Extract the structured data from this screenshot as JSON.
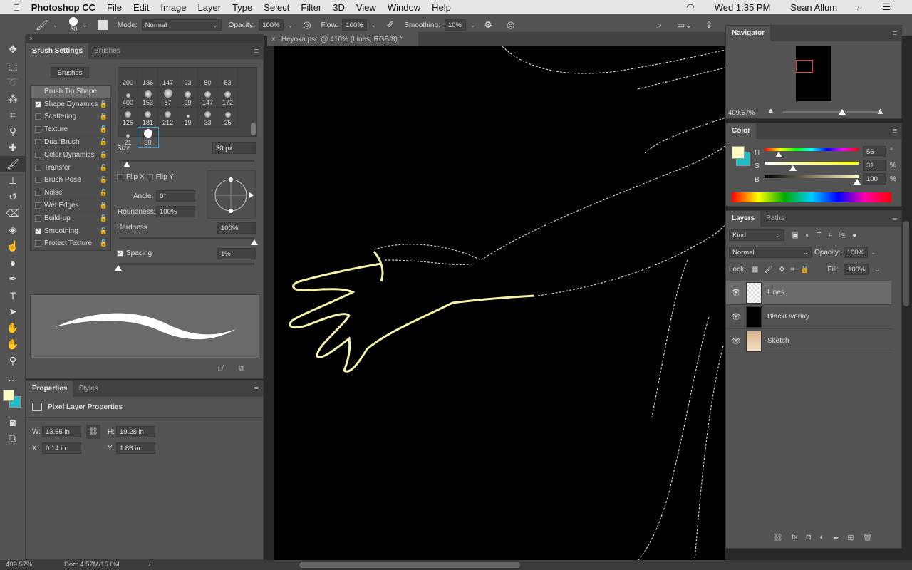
{
  "menubar": {
    "apple": "",
    "app": "Photoshop CC",
    "items": [
      "File",
      "Edit",
      "Image",
      "Layer",
      "Type",
      "Select",
      "Filter",
      "3D",
      "View",
      "Window",
      "Help"
    ],
    "clock": "Wed 1:35 PM",
    "user": "Sean Allum"
  },
  "options": {
    "brush_size": "30",
    "mode_label": "Mode:",
    "mode": "Normal",
    "opacity_label": "Opacity:",
    "opacity": "100%",
    "flow_label": "Flow:",
    "flow": "100%",
    "smoothing_label": "Smoothing:",
    "smoothing": "10%"
  },
  "document": {
    "tab": "Heyoka.psd @ 410% (Lines, RGB/8) *"
  },
  "brush_settings": {
    "tabs": [
      "Brush Settings",
      "Brushes"
    ],
    "brushes_button": "Brushes",
    "tip_shape": "Brush Tip Shape",
    "options": [
      {
        "label": "Shape Dynamics",
        "checked": true
      },
      {
        "label": "Scattering",
        "checked": false
      },
      {
        "label": "Texture",
        "checked": false
      },
      {
        "label": "Dual Brush",
        "checked": false
      },
      {
        "label": "Color Dynamics",
        "checked": false
      },
      {
        "label": "Transfer",
        "checked": false
      },
      {
        "label": "Brush Pose",
        "checked": false
      },
      {
        "label": "Noise",
        "checked": false
      },
      {
        "label": "Wet Edges",
        "checked": false
      },
      {
        "label": "Build-up",
        "checked": false
      },
      {
        "label": "Smoothing",
        "checked": true
      },
      {
        "label": "Protect Texture",
        "checked": false
      }
    ],
    "presets": [
      "200",
      "136",
      "147",
      "93",
      "50",
      "53",
      "400",
      "153",
      "87",
      "99",
      "147",
      "172",
      "126",
      "181",
      "212",
      "19",
      "33",
      "25",
      "21",
      "30"
    ],
    "selected_preset": "30",
    "size_label": "Size",
    "size": "30 px",
    "size_pct": 6,
    "flip_x": "Flip X",
    "flip_y": "Flip Y",
    "angle_label": "Angle:",
    "angle": "0°",
    "roundness_label": "Roundness:",
    "roundness": "100%",
    "hardness_label": "Hardness",
    "hardness": "100%",
    "spacing_label": "Spacing",
    "spacing": "1%",
    "spacing_checked": true
  },
  "properties": {
    "tabs": [
      "Properties",
      "Styles"
    ],
    "title": "Pixel Layer Properties",
    "w_label": "W:",
    "w": "13.65 in",
    "h_label": "H:",
    "h": "19.28 in",
    "x_label": "X:",
    "x": "0.14 in",
    "y_label": "Y:",
    "y": "1.88 in"
  },
  "navigator": {
    "title": "Navigator",
    "zoom": "409.57%"
  },
  "color": {
    "title": "Color",
    "h_label": "H",
    "h": "56",
    "h_unit": "°",
    "s_label": "S",
    "s": "31",
    "s_unit": "%",
    "b_label": "B",
    "b": "100",
    "b_unit": "%",
    "foreground": "#fffac0",
    "background": "#1fbcc4"
  },
  "layers": {
    "tabs": [
      "Layers",
      "Paths"
    ],
    "filter": "Kind",
    "blend": "Normal",
    "opacity_label": "Opacity:",
    "opacity": "100%",
    "lock_label": "Lock:",
    "fill_label": "Fill:",
    "fill": "100%",
    "items": [
      {
        "name": "Lines",
        "selected": true
      },
      {
        "name": "BlackOverlay",
        "selected": false
      },
      {
        "name": "Sketch",
        "selected": false
      }
    ]
  },
  "status": {
    "zoom": "409.57%",
    "doc": "Doc: 4.57M/15.0M"
  }
}
